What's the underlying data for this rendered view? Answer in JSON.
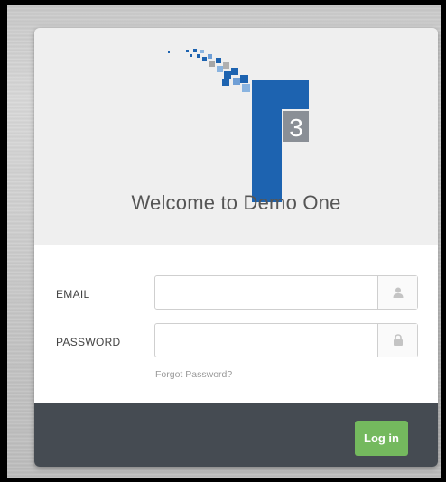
{
  "logo": {
    "glyph": "3"
  },
  "welcome_text": "Welcome to Demo One",
  "form": {
    "email_label": "EMAIL",
    "email_value": "",
    "email_icon": "user-icon",
    "password_label": "PASSWORD",
    "password_value": "",
    "password_icon": "lock-icon",
    "forgot_link": "Forgot Password?"
  },
  "login_button": "Log in",
  "colors": {
    "brand_blue": "#1d63b0",
    "login_green": "#74b95e",
    "footer_bar": "#454b52"
  }
}
